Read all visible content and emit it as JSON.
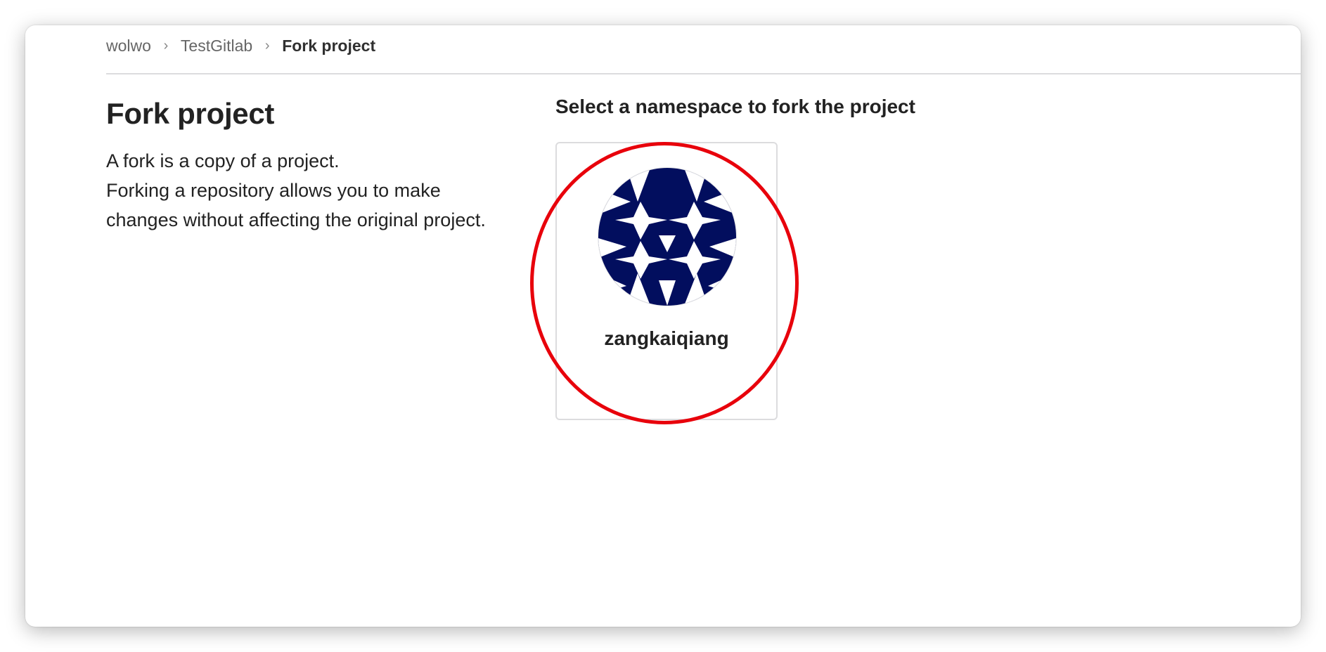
{
  "breadcrumb": {
    "items": [
      "wolwo",
      "TestGitlab"
    ],
    "current": "Fork project",
    "separator": "›"
  },
  "page": {
    "title": "Fork project",
    "description": [
      "A fork is a copy of a project.",
      "Forking a repository allows you to make changes without affecting the original project."
    ]
  },
  "namespace_section": {
    "title": "Select a namespace to fork the project",
    "namespaces": [
      {
        "name": "zangkaiqiang",
        "avatar_icon": "geometric-identicon"
      }
    ]
  },
  "colors": {
    "avatar_navy": "#020e5e",
    "highlight_red": "#e8000b",
    "border_gray": "#dcdcde"
  }
}
